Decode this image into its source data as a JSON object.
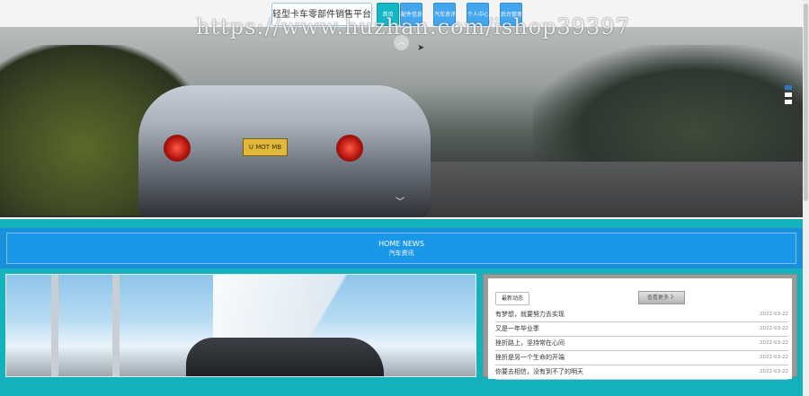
{
  "header": {
    "brand": "轻型卡车零部件销售平台",
    "nav": [
      {
        "label": "首页",
        "active": true
      },
      {
        "label": "配件信息",
        "active": false
      },
      {
        "label": "汽车资讯",
        "active": false
      },
      {
        "label": "个人中心",
        "active": false
      },
      {
        "label": "后台管理",
        "active": false
      }
    ]
  },
  "watermark": "https://www.huzhan.com/ishop39397",
  "banner": {
    "plate_text": "U MOT MB",
    "up_arrow": "︿",
    "down_arrow": "﹀",
    "slide_count": 3,
    "active_slide": 1
  },
  "news_section": {
    "title_en": "HOME NEWS",
    "title_cn": "汽车资讯"
  },
  "latest": {
    "tag": "最新动态",
    "more_label": "查看更多 》",
    "items": [
      {
        "title": "有梦想，就要努力去实现",
        "date": "2022-03-22"
      },
      {
        "title": "又是一年毕业季",
        "date": "2022-03-22"
      },
      {
        "title": "挫折路上，坚持常在心间",
        "date": "2022-03-22"
      },
      {
        "title": "挫折是另一个生命的开端",
        "date": "2022-03-22"
      },
      {
        "title": "你要去相信，没有到不了的明天",
        "date": "2022-03-22"
      }
    ]
  },
  "colors": {
    "accent_teal": "#14b2bc",
    "nav_blue": "#43a6ee",
    "news_blue": "#1a90dc"
  }
}
